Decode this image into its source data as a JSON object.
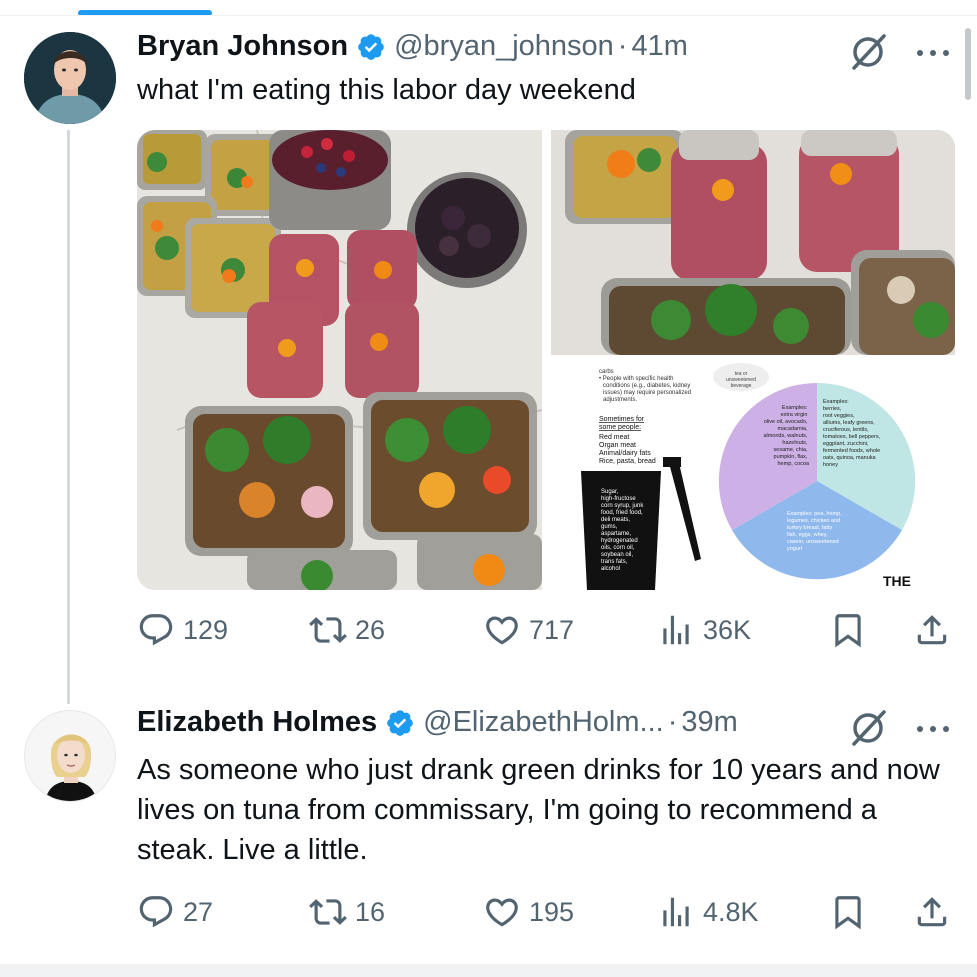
{
  "thread": {
    "tweets": [
      {
        "author": {
          "name": "Bryan Johnson",
          "handle": "@bryan_johnson",
          "verified": true
        },
        "time": "41m",
        "text": "what I'm eating this labor day weekend",
        "stats": {
          "replies": "129",
          "retweets": "26",
          "likes": "717",
          "views": "36K"
        }
      },
      {
        "author": {
          "name": "Elizabeth Holmes",
          "handle": "@ElizabethHolm...",
          "verified": true
        },
        "time": "39m",
        "text": "As someone who just drank green drinks for 10 years and now lives on tuna from commissary, I'm going to recommend a steak. Live a little.",
        "stats": {
          "replies": "27",
          "retweets": "16",
          "likes": "195",
          "views": "4.8K"
        }
      }
    ]
  },
  "separator": "·",
  "media": {
    "infographic": {
      "top_note": "carbs\n• People with specific health conditions (e.g., diabetes, kidney issues) may require personalized adjustments.",
      "bubble": "tea or unsweetened beverage",
      "sometimes_heading": "Sometimes for some people:",
      "sometimes_items": "Red meat\nOrgan meat\nAnimal/dairy fats\nRice, pasta, bread",
      "trash_text": "Sugar, high-fructose corn syrup, junk food, fried food, deli meats, gums, aspartame, hydrogenated oils, corn oil, soybean oil, trans fats, alcohol",
      "pie_fats": "Examples: extra virgin olive oil, avocado, macadamia, almonds, walnuts, hazelnuts, sesame, chia, pumpkin, flax, hemp, cocoa",
      "pie_veg": "Examples: berries, root veggies, alliums, leafy greens, cruciferous, lentils, tomatoes, bell peppers, eggplant, zucchini, fermented foods, whole oats, quinoa, manuka honey",
      "pie_protein": "Examples: pea, hemp, legumes, chicken and turkey breast, fatty fish, eggs, whey, casein, unsweetened yogurt",
      "corner_label": "THE"
    }
  },
  "colors": {
    "accent": "#1d9bf0",
    "text": "#0f1419",
    "secondary": "#536471",
    "thread_line": "#cfd9de",
    "pie_fats": "#cdb0e6",
    "pie_veg": "#bfe6e4",
    "pie_protein": "#8fb8ec"
  },
  "icons": [
    "verified-badge-icon",
    "grok-icon",
    "more-icon",
    "reply-icon",
    "retweet-icon",
    "like-icon",
    "views-icon",
    "bookmark-icon",
    "share-icon"
  ]
}
